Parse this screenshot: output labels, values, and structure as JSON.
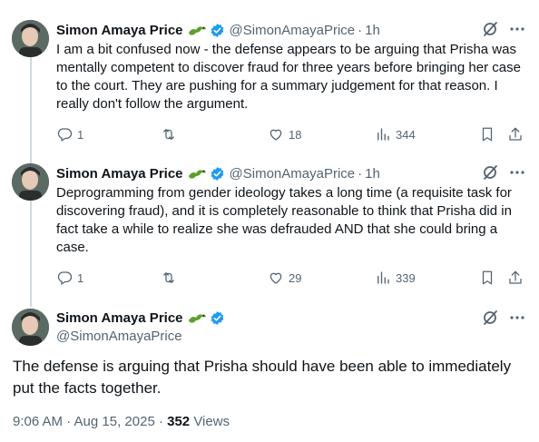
{
  "tweets": [
    {
      "author_name": "Simon Amaya Price",
      "handle": "@SimonAmayaPrice",
      "time": "1h",
      "text": "I am a bit confused now - the defense appears to be arguing that Prisha was mentally competent to discover fraud for three years before bringing her case to the court. They are pushing for a summary judgement for that reason. I really don't follow the argument.",
      "replies": "1",
      "likes": "18",
      "views": "344"
    },
    {
      "author_name": "Simon Amaya Price",
      "handle": "@SimonAmayaPrice",
      "time": "1h",
      "text": "Deprogramming from gender ideology takes a long time (a requisite task for discovering fraud), and it is completely reasonable to think that Prisha did in fact take a while to realize she was defrauded AND that she could bring a case.",
      "replies": "1",
      "likes": "29",
      "views": "339"
    }
  ],
  "main_tweet": {
    "author_name": "Simon Amaya Price",
    "handle": "@SimonAmayaPrice",
    "text": "The defense is arguing that Prisha should have been able to immediately put the facts together.",
    "timestamp": "9:06 AM · Aug 15, 2025 · ",
    "views_count": "352",
    "views_label": " Views"
  },
  "separator": "·",
  "icons": {
    "name_emoji": "lizard-emoji-icon",
    "verified": "verified-badge-icon",
    "grok": "grok-icon",
    "more": "more-dots-icon",
    "reply": "reply-icon",
    "retweet": "retweet-icon",
    "like": "heart-icon",
    "views": "views-bar-icon",
    "bookmark": "bookmark-icon",
    "share": "share-icon"
  },
  "colors": {
    "text": "#0f1419",
    "secondary": "#536471",
    "verified": "#1d9bf0",
    "thread_line": "#cfd9de",
    "lizard": "#5aa02c"
  }
}
